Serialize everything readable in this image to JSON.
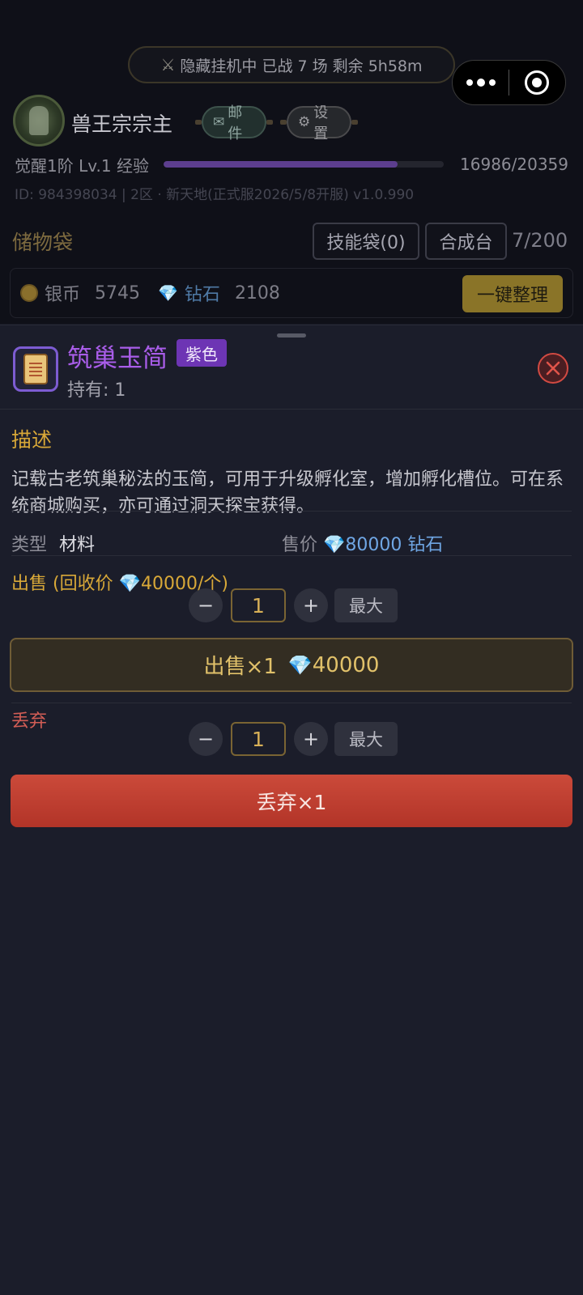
{
  "header": {
    "afk_status": "隐藏挂机中  已战 7 场  剩余 5h58m",
    "player_name": "兽王宗宗主",
    "mail_label": "邮件",
    "settings_label": "设置",
    "level_label": "觉醒1阶 Lv.1 经验",
    "exp_text": "16986/20359",
    "exp_progress": 0.834,
    "id_line": "ID: 984398034  | 2区 · 新天地(正式服2026/5/8开服)  v1.0.990"
  },
  "bag": {
    "title": "储物袋",
    "skill_bag_label": "技能袋(0)",
    "craft_label": "合成台",
    "capacity": "7/200",
    "silver_label": "银币",
    "silver_value": "5745",
    "diamond_label": "钻石",
    "diamond_value": "2108",
    "sort_label": "一键整理"
  },
  "item": {
    "name": "筑巢玉简",
    "rarity": "紫色",
    "owned": "持有: 1",
    "desc_title": "描述",
    "description": "记载古老筑巢秘法的玉简，可用于升级孵化室，增加孵化槽位。可在系统商城购买，亦可通过洞天探宝获得。",
    "type_key": "类型",
    "type_value": "材料",
    "price_key": "售价",
    "price_value": "80000 钻石",
    "sell_title_prefix": "出售 (回收价 ",
    "sell_title_suffix": "40000/个)",
    "sell_qty": "1",
    "max_label": "最大",
    "sell_button_prefix": "出售×1",
    "sell_button_value": "40000",
    "drop_title": "丢弃",
    "drop_qty": "1",
    "drop_button": "丢弃×1"
  },
  "colors": {
    "accent_gold": "#d8a838",
    "rarity_purple": "#a95de9",
    "danger_red": "#c4402f",
    "diamond_blue": "#5aa1e6"
  },
  "icons": {
    "afk": "crossed-swords-icon",
    "mail": "mail-icon",
    "settings": "gear-icon",
    "item": "scroll-icon",
    "close": "close-icon",
    "currency_silver": "coin-icon",
    "currency_diamond": "diamond-icon"
  }
}
